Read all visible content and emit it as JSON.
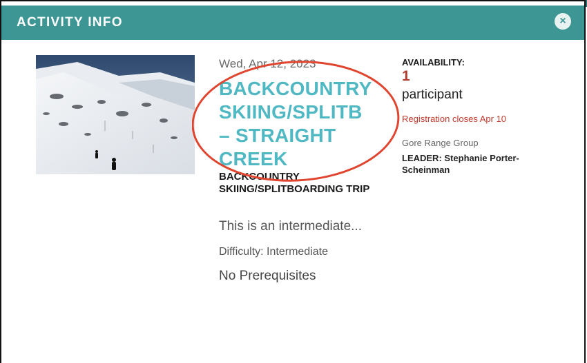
{
  "modal": {
    "header_title": "ACTIVITY INFO",
    "close_label": "×",
    "accent_color": "#3d9694"
  },
  "activity": {
    "date": "Wed, Apr 12, 2023",
    "title_lines": [
      "BACKCOUNTRY",
      "SKIING/SPLITB",
      "– STRAIGHT",
      "CREEK"
    ],
    "subtitle": "BACKCOUNTRY SKIING/SPLITBOARDING TRIP",
    "description": "This is an intermediate...",
    "difficulty": "Difficulty: Intermediate",
    "prerequisites": "No Prerequisites",
    "photo_alt": "skiers on snowy slope"
  },
  "availability": {
    "label": "AVAILABILITY:",
    "count": "1",
    "unit": "participant",
    "registration_closes": "Registration closes Apr 10",
    "group": "Gore Range Group",
    "leader_label": "LEADER:",
    "leader_name": "Stephanie Porter-Scheinman"
  }
}
